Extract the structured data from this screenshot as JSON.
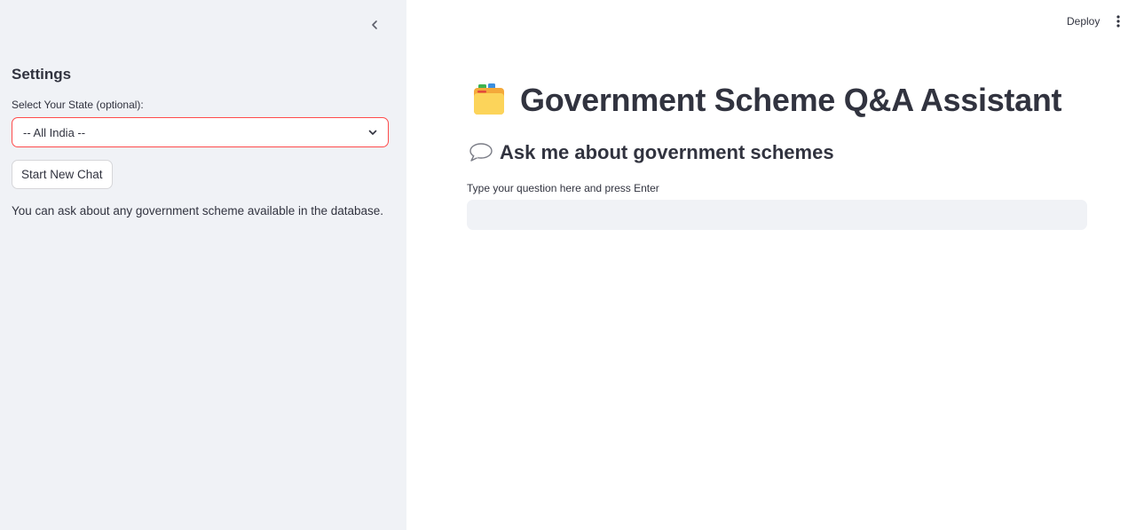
{
  "header": {
    "deploy_label": "Deploy",
    "menu_icon": "vertical-ellipsis-icon"
  },
  "sidebar": {
    "collapse_icon": "chevron-left-icon",
    "title": "Settings",
    "state_select": {
      "label": "Select Your State (optional):",
      "selected_value": "-- All India --",
      "chevron_icon": "chevron-down-icon",
      "border_color": "#ff4b4b"
    },
    "new_chat_label": "Start New Chat",
    "note": "You can ask about any government scheme available in the database."
  },
  "main": {
    "title_icon": "card-index-dividers-icon",
    "title": "Government Scheme Q&A Assistant",
    "subtitle_icon": "speech-balloon-icon",
    "subtitle": "Ask me about government schemes",
    "question_input": {
      "label": "Type your question here and press Enter",
      "value": "",
      "placeholder": ""
    }
  },
  "colors": {
    "sidebar_bg": "#f0f2f6",
    "text": "#31333f",
    "accent": "#ff4b4b",
    "input_bg": "#f0f2f6"
  }
}
